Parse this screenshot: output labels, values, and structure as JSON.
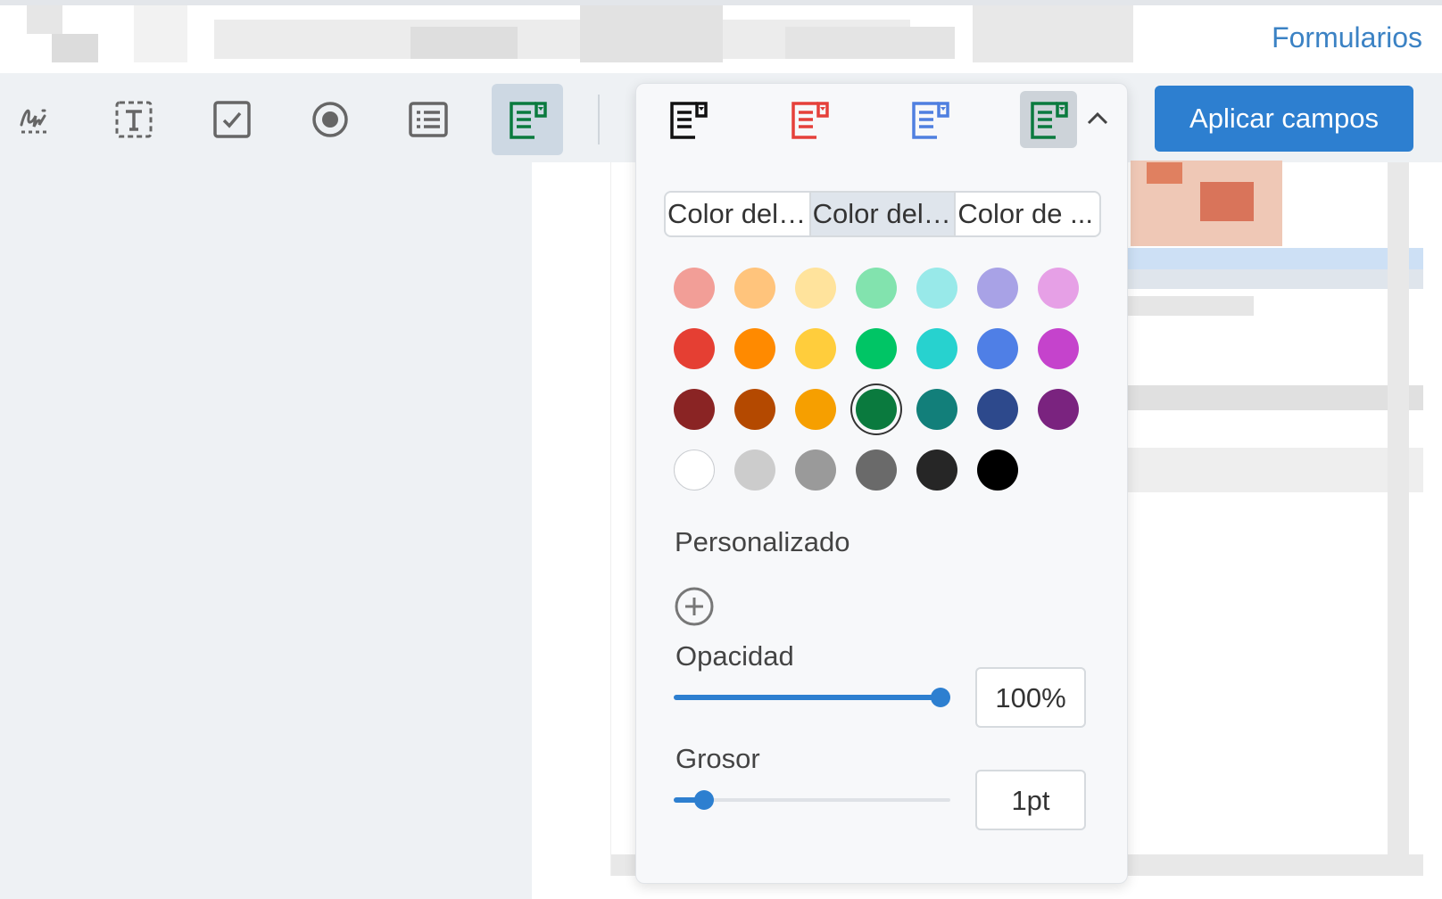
{
  "header": {
    "link_label": "Formularios"
  },
  "toolbar": {
    "tools": [
      {
        "name": "signature-tool",
        "icon": "signature-icon"
      },
      {
        "name": "text-field-tool",
        "icon": "text-field-icon"
      },
      {
        "name": "checkbox-tool",
        "icon": "checkbox-icon"
      },
      {
        "name": "radio-tool",
        "icon": "radio-icon"
      },
      {
        "name": "list-tool",
        "icon": "list-icon"
      },
      {
        "name": "dropdown-tool",
        "icon": "dropdown-field-icon",
        "active": true
      }
    ],
    "apply_label": "Aplicar campos"
  },
  "style_popup": {
    "styles": [
      {
        "icon": "dropdown-field-icon",
        "color": "#111111"
      },
      {
        "icon": "dropdown-field-icon",
        "color": "#e5403a"
      },
      {
        "icon": "dropdown-field-icon",
        "color": "#4f7fe0"
      },
      {
        "icon": "dropdown-field-icon",
        "color": "#0a7a3e",
        "active": true
      }
    ],
    "tabs": [
      {
        "label": "Color del ...",
        "active": false
      },
      {
        "label": "Color del ...",
        "active": true
      },
      {
        "label": "Color de ...",
        "active": false
      }
    ],
    "swatch_rows": [
      [
        "#f29e97",
        "#ffc47c",
        "#ffe39c",
        "#82e3ae",
        "#98e9e9",
        "#a8a2e6",
        "#e6a0e6"
      ],
      [
        "#e53f33",
        "#ff8a00",
        "#ffcd3c",
        "#00c565",
        "#27d2cf",
        "#4f7fe6",
        "#c543cc"
      ],
      [
        "#8a2424",
        "#b44900",
        "#f69f00",
        "#0a7a3e",
        "#127f7a",
        "#2d498c",
        "#7a237f"
      ],
      [
        "#ffffff",
        "#cccccc",
        "#9a9a9a",
        "#6a6a6a",
        "#262626",
        "#000000"
      ]
    ],
    "selected_color": "#0a7a3e",
    "custom_label": "Personalizado",
    "opacity_label": "Opacidad",
    "opacity_value": "100%",
    "opacity_fraction": 1.0,
    "thickness_label": "Grosor",
    "thickness_value": "1pt",
    "thickness_fraction": 0.08
  }
}
